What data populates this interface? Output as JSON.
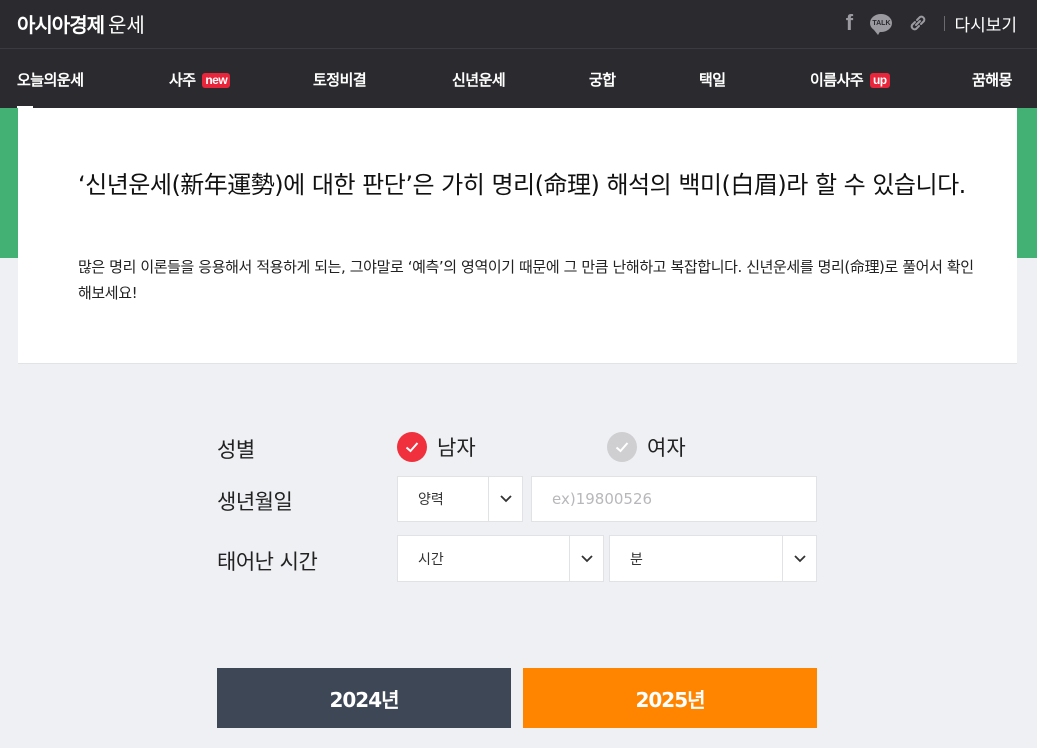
{
  "header": {
    "brand_bold": "아시아경제",
    "brand_light": "운세",
    "facebook_glyph": "f",
    "talk_glyph": "TALK",
    "again_label": "다시보기",
    "icons": [
      "facebook-icon",
      "kakaotalk-icon",
      "link-icon"
    ]
  },
  "nav": {
    "items": [
      {
        "label": "오늘의운세",
        "tag": ""
      },
      {
        "label": "사주",
        "tag": "new"
      },
      {
        "label": "토정비결",
        "tag": ""
      },
      {
        "label": "신년운세",
        "tag": ""
      },
      {
        "label": "궁합",
        "tag": ""
      },
      {
        "label": "택일",
        "tag": ""
      },
      {
        "label": "이름사주",
        "tag": "up"
      },
      {
        "label": "꿈해몽",
        "tag": ""
      }
    ]
  },
  "intro": {
    "title": "‘신년운세(新年運勢)에 대한 판단’은 가히 명리(命理) 해석의 백미(白眉)라 할 수 있습니다.",
    "desc": "많은 명리 이론들을 응용해서 적용하게 되는, 그야말로 ‘예측’의 영역이기 때문에 그 만큼 난해하고 복잡합니다. 신년운세를 명리(命理)로 풀어서 확인해보세요!"
  },
  "form": {
    "gender_label": "성별",
    "male_label": "남자",
    "female_label": "여자",
    "selected_gender": "male",
    "birth_label": "생년월일",
    "calendar_value": "양력",
    "birth_placeholder": "ex)19800526",
    "time_label": "태어난 시간",
    "hour_value": "시간",
    "minute_value": "분"
  },
  "buttons": {
    "y2024": "2024년",
    "y2025": "2025년"
  },
  "colors": {
    "topbar": "#2a2a2f",
    "green": "#43b173",
    "red": "#f0303c",
    "button_dark": "#3d4755",
    "button_orange": "#ff8400"
  }
}
